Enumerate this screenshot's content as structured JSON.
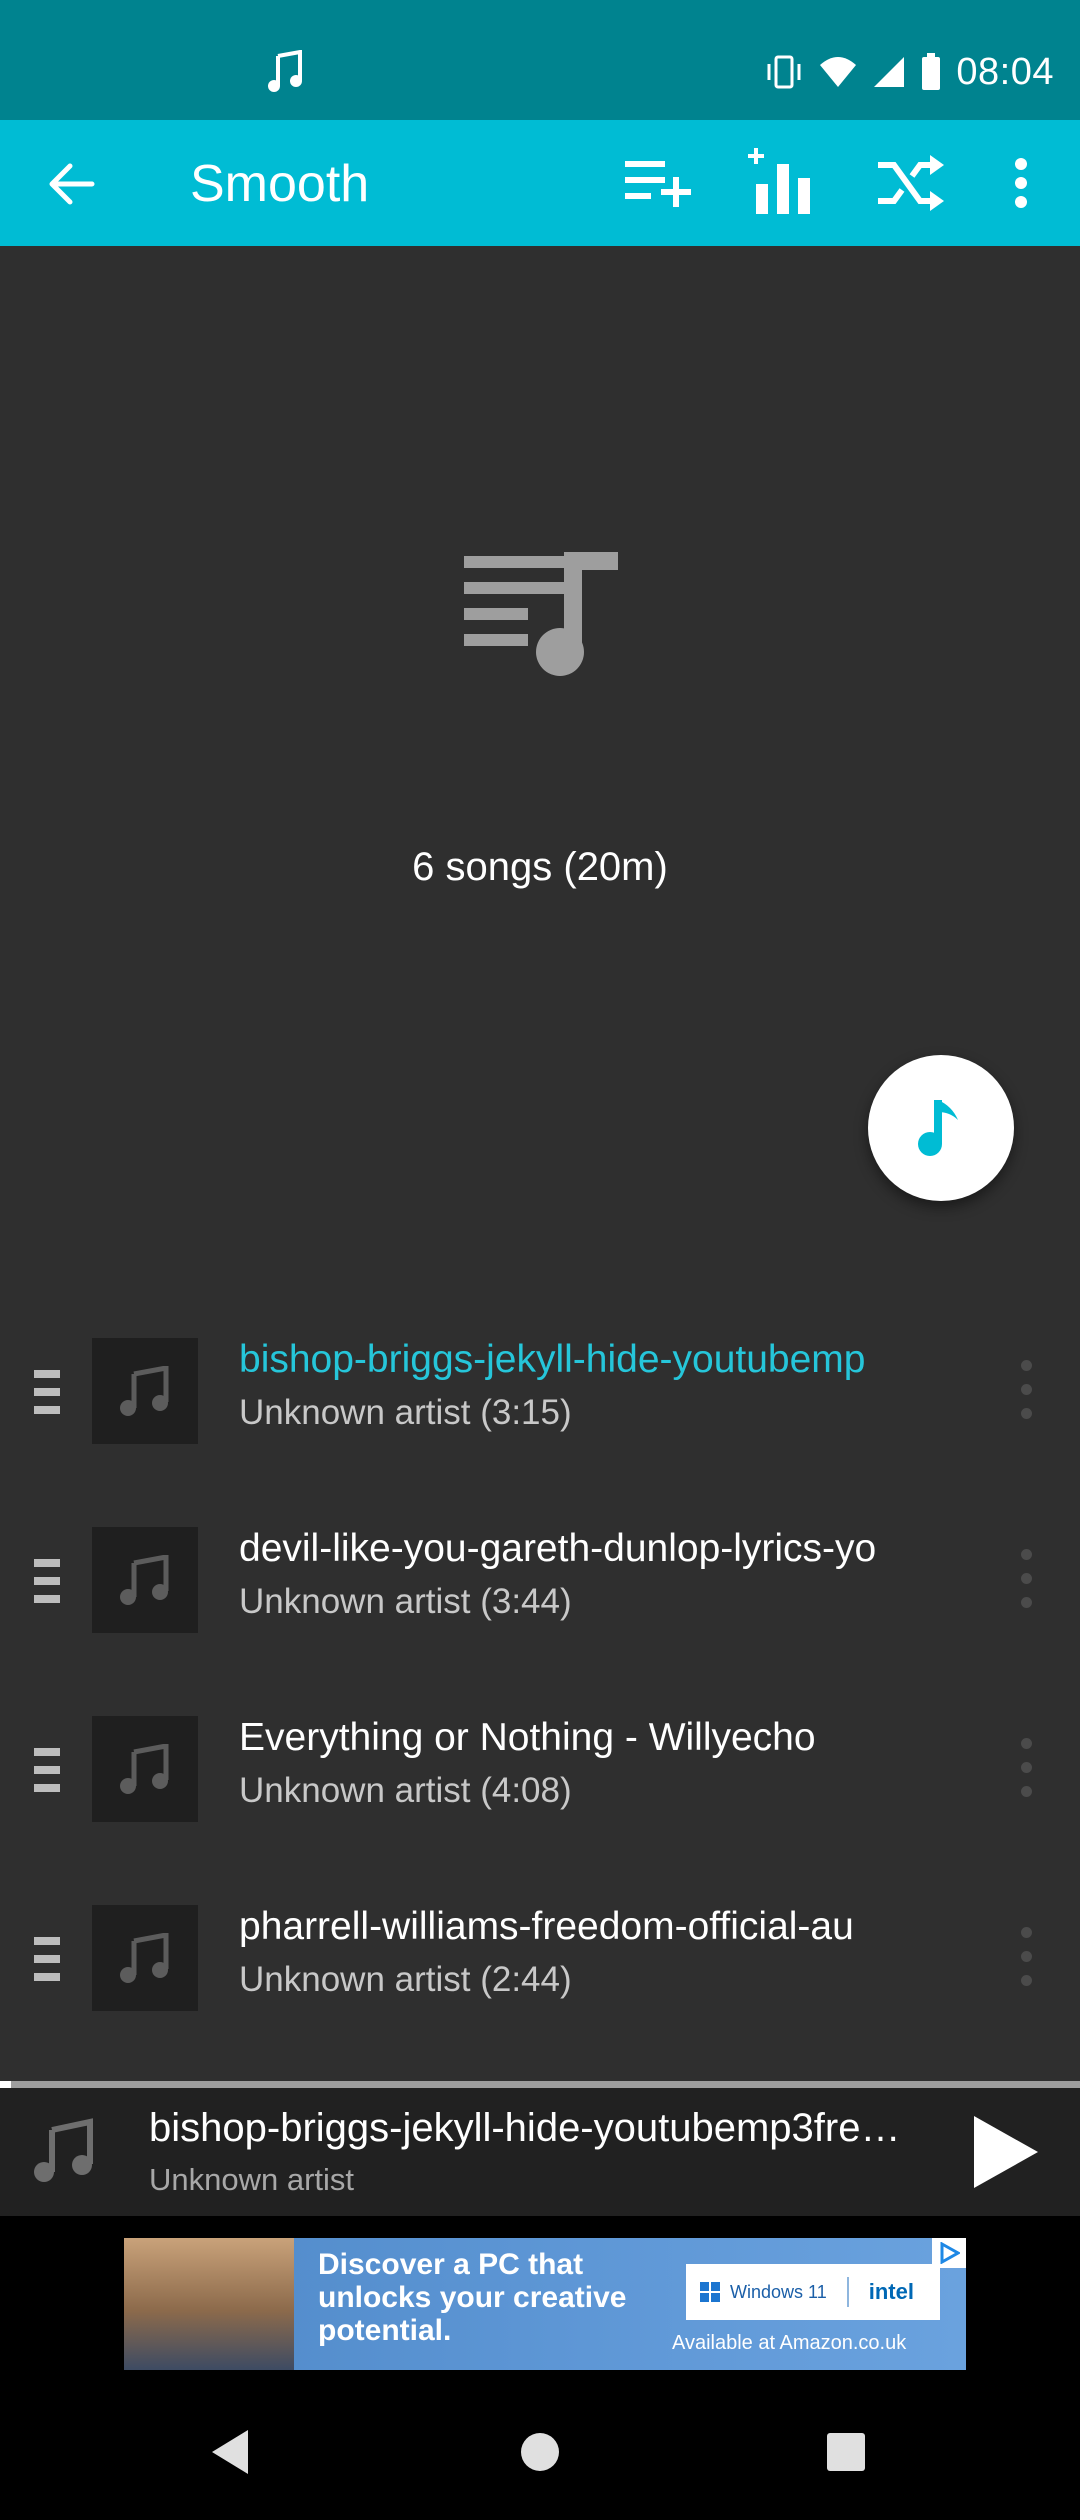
{
  "status_bar": {
    "time": "08:04",
    "icons": [
      "music-note-icon",
      "vibrate-icon",
      "wifi-icon",
      "signal-icon",
      "battery-icon"
    ]
  },
  "toolbar": {
    "title": "Smooth",
    "icons": [
      "back-arrow-icon",
      "add-to-queue-icon",
      "equalizer-icon",
      "shuffle-icon",
      "more-vert-icon"
    ]
  },
  "playlist": {
    "summary": "6 songs (20m)",
    "icon": "playlist-music-icon",
    "fab_icon": "music-note-icon"
  },
  "songs": [
    {
      "title": "bishop-briggs-jekyll-hide-youtubemp",
      "subtitle": "Unknown artist (3:15)",
      "active": true
    },
    {
      "title": "devil-like-you-gareth-dunlop-lyrics-yo",
      "subtitle": "Unknown artist (3:44)",
      "active": false
    },
    {
      "title": "Everything or Nothing - Willyecho",
      "subtitle": "Unknown artist (4:08)",
      "active": false
    },
    {
      "title": "pharrell-williams-freedom-official-au",
      "subtitle": "Unknown artist (2:44)",
      "active": false
    }
  ],
  "mini_player": {
    "title": "bishop-briggs-jekyll-hide-youtubemp3fre…",
    "subtitle": "Unknown artist",
    "progress": 0.01
  },
  "ad": {
    "headline": "Discover a PC that unlocks your creative potential.",
    "badge_windows": "Windows 11",
    "badge_intel": "intel",
    "footer": "Available at Amazon.co.uk"
  },
  "nav_bar": {
    "icons": [
      "nav-back-icon",
      "nav-home-icon",
      "nav-recents-icon"
    ]
  },
  "colors": {
    "status_bar": "#00838f",
    "toolbar": "#00bcd4",
    "accent": "#26c6da",
    "background": "#2f2f2f"
  }
}
